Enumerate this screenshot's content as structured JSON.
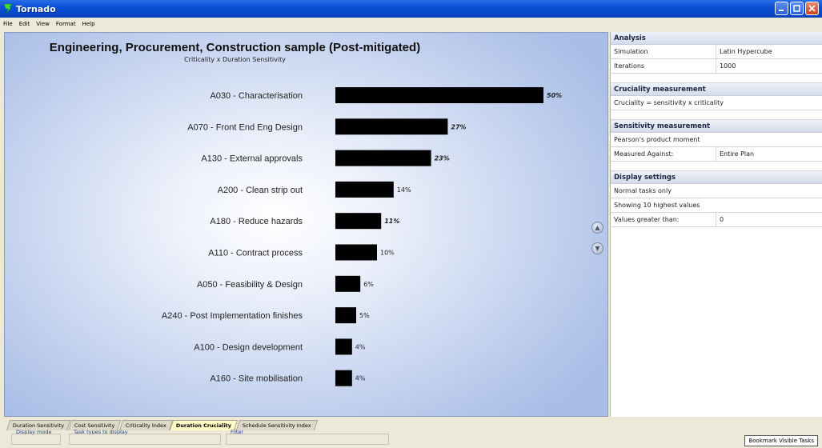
{
  "window": {
    "title": "Tornado"
  },
  "menu": [
    "File",
    "Edit",
    "View",
    "Format",
    "Help"
  ],
  "chart": {
    "title": "Engineering, Procurement, Construction sample (Post-mitigated)",
    "subtitle": "Criticality x Duration Sensitivity"
  },
  "chart_data": {
    "type": "bar",
    "orientation": "horizontal",
    "title": "Engineering, Procurement, Construction sample (Post-mitigated)",
    "subtitle": "Criticality x Duration Sensitivity",
    "categories": [
      "A030 - Characterisation",
      "A070 - Front End Eng Design",
      "A130 - External approvals",
      "A200 - Clean strip out",
      "A180 - Reduce hazards",
      "A110 - Contract process",
      "A050 - Feasibility & Design",
      "A240 - Post Implementation finishes",
      "A100 - Design development",
      "A160 - Site mobilisation"
    ],
    "values": [
      50,
      27,
      23,
      14,
      11,
      10,
      6,
      5,
      4,
      4
    ],
    "labels": [
      "50%",
      "27%",
      "23%",
      "14%",
      "11%",
      "10%",
      "6%",
      "5%",
      "4%",
      "4%"
    ],
    "bold_labels": [
      true,
      true,
      true,
      false,
      true,
      false,
      false,
      false,
      false,
      false
    ],
    "unit": "%",
    "bar_color": "#000000",
    "grid": false,
    "legend": "none"
  },
  "panel": {
    "sections": [
      {
        "title": "Analysis",
        "rows": [
          {
            "k": "Simulation",
            "v": "Latin Hypercube"
          },
          {
            "k": "Iterations",
            "v": "1000"
          }
        ]
      },
      {
        "title": "Cruciality measurement",
        "rows": [
          {
            "k": "Cruciality = sensitivity x criticality"
          }
        ]
      },
      {
        "title": "Sensitivity measurement",
        "rows": [
          {
            "k": "Pearson's product moment"
          },
          {
            "k": "Measured Against:",
            "v": "Entire Plan"
          }
        ]
      },
      {
        "title": "Display settings",
        "rows": [
          {
            "k": "Normal tasks only"
          },
          {
            "k": "Showing 10 highest values"
          },
          {
            "k": "Values greater than:",
            "v": "0"
          }
        ]
      }
    ]
  },
  "tabs": [
    {
      "label": "Duration Sensitivity",
      "active": false
    },
    {
      "label": "Cost Sensitivity",
      "active": false
    },
    {
      "label": "Criticality Index",
      "active": false
    },
    {
      "label": "Duration Cruciality",
      "active": true
    },
    {
      "label": "Schedule Sensitivity Index",
      "active": false
    }
  ],
  "controls": {
    "display_mode": "Display mode",
    "task_types": "Task types to display",
    "filter": "Filter",
    "bookmark": "Bookmark Visible Tasks"
  },
  "colors": {
    "titlebar": "#0a4fd6",
    "active_tab": "#fff9c4",
    "section_header": "#d3dceb"
  }
}
